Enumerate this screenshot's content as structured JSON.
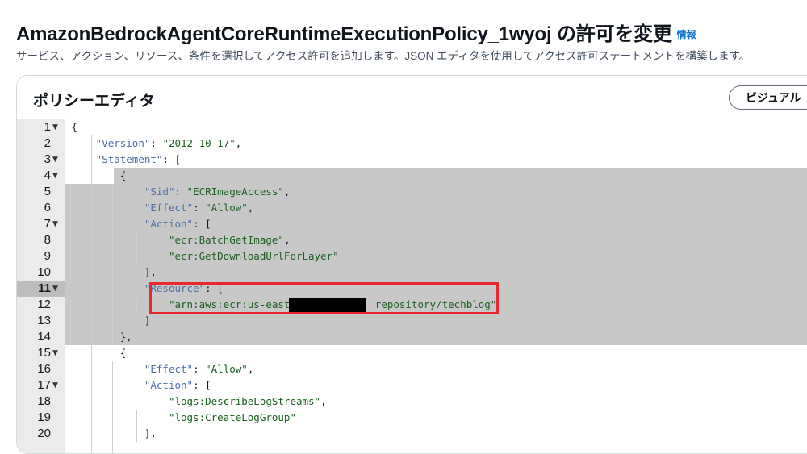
{
  "header": {
    "title": "AmazonBedrockAgentCoreRuntimeExecutionPolicy_1wyoj の許可を変更",
    "info_link": "情報",
    "description": "サービス、アクション、リソース、条件を選択してアクセス許可を追加します。JSON エディタを使用してアクセス許可ステートメントを構築します。"
  },
  "panel": {
    "title": "ポリシーエディタ",
    "visual_button": "ビジュアル"
  },
  "editor": {
    "active_line": 11,
    "lines": [
      {
        "n": "1",
        "fold": "▼",
        "text": "{"
      },
      {
        "n": "2",
        "fold": "",
        "text": "    \"Version\": \"2012-10-17\","
      },
      {
        "n": "3",
        "fold": "▼",
        "text": "    \"Statement\": ["
      },
      {
        "n": "4",
        "fold": "▼",
        "text": "        {"
      },
      {
        "n": "5",
        "fold": "",
        "text": "            \"Sid\": \"ECRImageAccess\","
      },
      {
        "n": "6",
        "fold": "",
        "text": "            \"Effect\": \"Allow\","
      },
      {
        "n": "7",
        "fold": "▼",
        "text": "            \"Action\": ["
      },
      {
        "n": "8",
        "fold": "",
        "text": "                \"ecr:BatchGetImage\","
      },
      {
        "n": "9",
        "fold": "",
        "text": "                \"ecr:GetDownloadUrlForLayer\""
      },
      {
        "n": "10",
        "fold": "",
        "text": "            ],"
      },
      {
        "n": "11",
        "fold": "▼",
        "text": "            \"Resource\": ["
      },
      {
        "n": "12",
        "fold": "",
        "text": "                \"arn:aws:ecr:us-east-1            repository/techblog\""
      },
      {
        "n": "13",
        "fold": "",
        "text": "            ]"
      },
      {
        "n": "14",
        "fold": "",
        "text": "        },"
      },
      {
        "n": "15",
        "fold": "▼",
        "text": "        {"
      },
      {
        "n": "16",
        "fold": "",
        "text": "            \"Effect\": \"Allow\","
      },
      {
        "n": "17",
        "fold": "▼",
        "text": "            \"Action\": ["
      },
      {
        "n": "18",
        "fold": "",
        "text": "                \"logs:DescribeLogStreams\","
      },
      {
        "n": "19",
        "fold": "",
        "text": "                \"logs:CreateLogGroup\""
      },
      {
        "n": "20",
        "fold": "",
        "text": "            ],"
      }
    ]
  },
  "colors": {
    "highlight_box": "#e8282b",
    "info_link": "#0972d3",
    "selection": "#c8c8c8"
  }
}
